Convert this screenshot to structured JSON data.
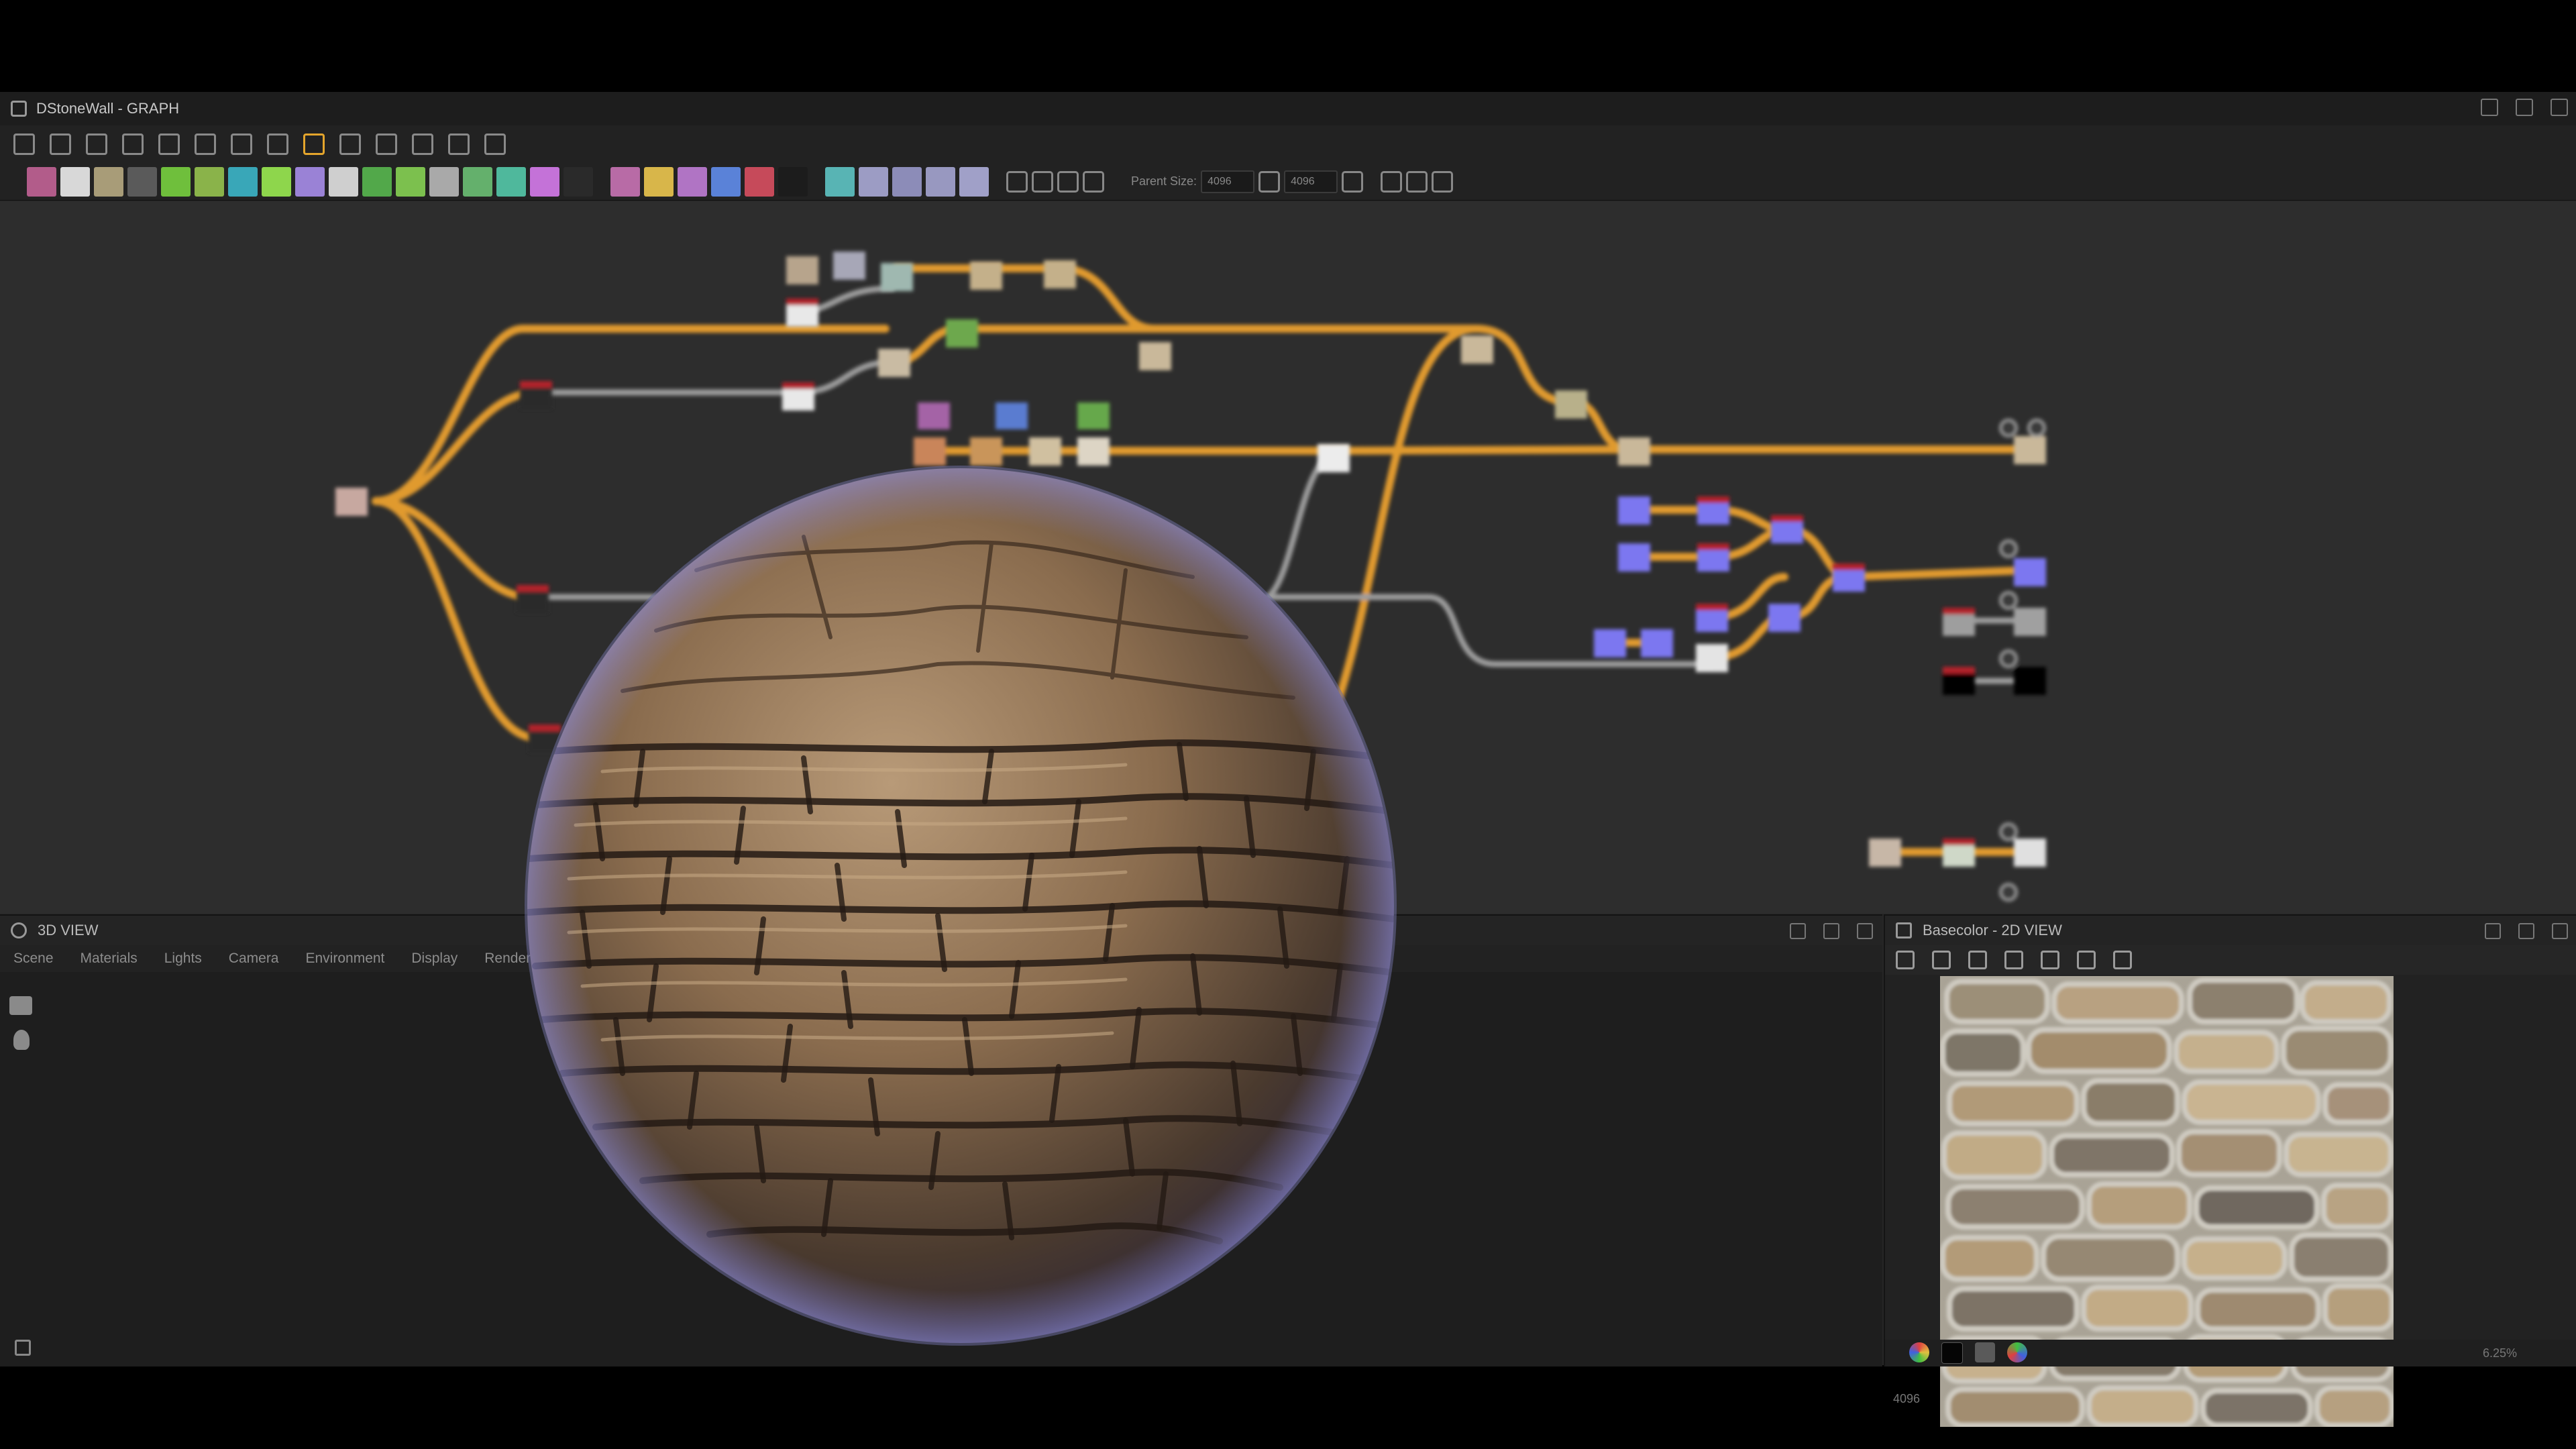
{
  "window": {
    "title": "DStoneWall - GRAPH"
  },
  "toolbar": {
    "parent_size_label": "Parent Size:",
    "parent_size_value": "4096",
    "output_size_value": "4096"
  },
  "view3d": {
    "title": "3D VIEW",
    "menu": [
      "Scene",
      "Materials",
      "Lights",
      "Camera",
      "Environment",
      "Display",
      "Renderer"
    ]
  },
  "view2d": {
    "title": "Basecolor - 2D VIEW",
    "resolution": "4096",
    "zoom": "6.25%"
  },
  "colors": {
    "connection_orange": "#e09a2e",
    "connection_grey": "#9c9c9c",
    "node_blue": "#7c77f0",
    "node_red_header": "#b3202a"
  },
  "icons": [
    "window-icon",
    "3d-view-icon",
    "2d-view-icon",
    "camera-icon",
    "light-icon"
  ]
}
